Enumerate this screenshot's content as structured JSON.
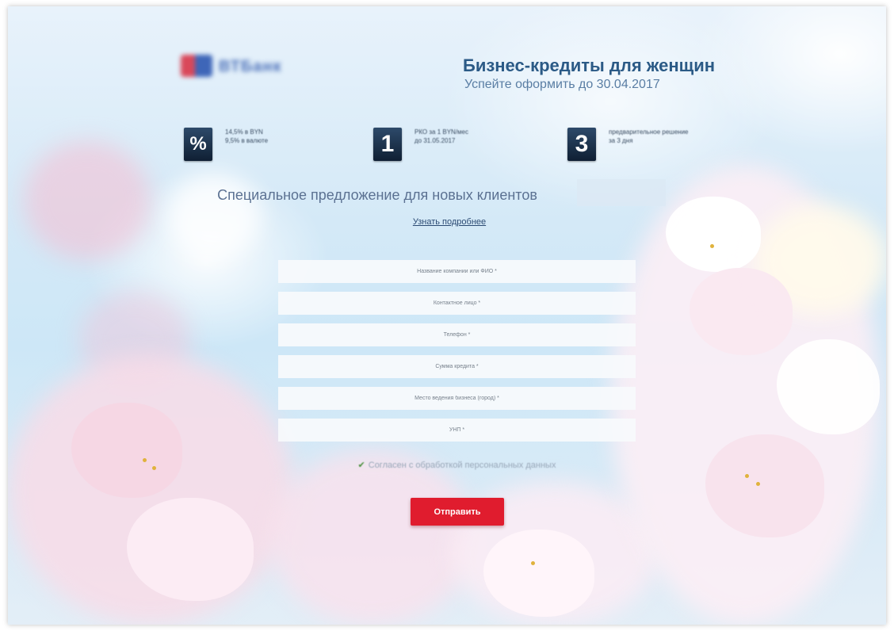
{
  "brand": {
    "logo_text": "ВТБанк"
  },
  "hero": {
    "title": "Бизнес-кредиты для женщин",
    "subtitle": "Успейте оформить до 30.04.2017"
  },
  "features": [
    {
      "icon": "%",
      "line1": "14,5% в BYN",
      "line2": "9,5% в валюте"
    },
    {
      "icon": "1",
      "line1": "РКО за 1 BYN/мес",
      "line2": "до 31.05.2017"
    },
    {
      "icon": "3",
      "line1": "предварительное решение",
      "line2": "за 3 дня"
    }
  ],
  "offer": {
    "text": "Специальное предложение для новых клиентов",
    "more_link": "Узнать подробнее"
  },
  "form": {
    "company_placeholder": "Название компании или ФИО *",
    "contact_placeholder": "Контактное лицо *",
    "phone_placeholder": "Телефон *",
    "amount_placeholder": "Сумма кредита *",
    "city_placeholder": "Место ведения бизнеса (город) *",
    "unp_placeholder": "УНП *",
    "consent_label": "Согласен с обработкой персональных данных",
    "submit_label": "Отправить"
  },
  "colors": {
    "accent": "#e01c2e",
    "heading": "#2b5a86",
    "sky": "#cde7f7"
  }
}
